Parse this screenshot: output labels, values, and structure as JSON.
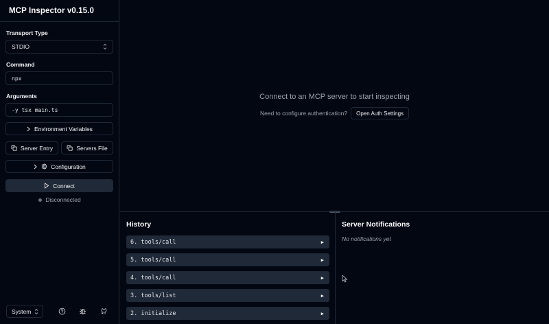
{
  "app": {
    "title": "MCP Inspector v0.15.0"
  },
  "sidebar": {
    "transport_label": "Transport Type",
    "transport_value": "STDIO",
    "command_label": "Command",
    "command_value": "npx",
    "arguments_label": "Arguments",
    "arguments_value": "-y tsx main.ts",
    "env_button": "Environment Variables",
    "server_entry_button": "Server Entry",
    "servers_file_button": "Servers File",
    "configuration_button": "Configuration",
    "connect_button": "Connect",
    "status_text": "Disconnected",
    "theme_value": "System"
  },
  "main": {
    "empty_title": "Connect to an MCP server to start inspecting",
    "auth_prompt": "Need to configure authentication?",
    "auth_button": "Open Auth Settings"
  },
  "history": {
    "title": "History",
    "items": [
      {
        "label": "6. tools/call"
      },
      {
        "label": "5. tools/call"
      },
      {
        "label": "4. tools/call"
      },
      {
        "label": "3. tools/list"
      },
      {
        "label": "2. initialize"
      }
    ]
  },
  "notifications": {
    "title": "Server Notifications",
    "empty_text": "No notifications yet"
  },
  "colors": {
    "background": "#030712",
    "border": "#1f2937",
    "muted_text": "#9ca3af",
    "status_dot": "#6b7280"
  }
}
